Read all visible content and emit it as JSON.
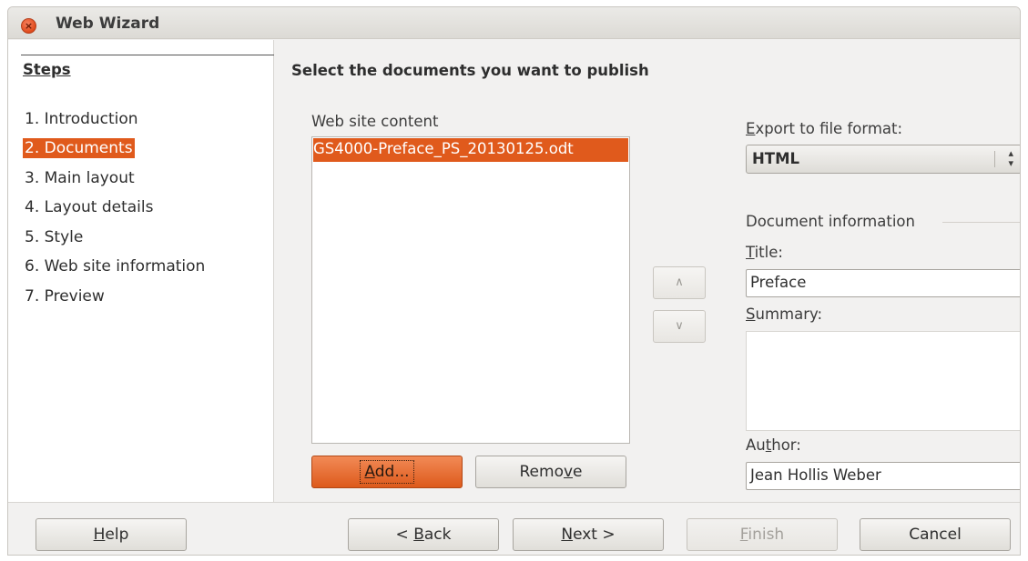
{
  "window": {
    "title": "Web Wizard"
  },
  "sidebar": {
    "heading": "Steps",
    "steps": [
      {
        "label": "1. Introduction",
        "active": false
      },
      {
        "label": "2. Documents",
        "active": true
      },
      {
        "label": "3. Main layout",
        "active": false
      },
      {
        "label": "4. Layout details",
        "active": false
      },
      {
        "label": "5. Style",
        "active": false
      },
      {
        "label": "6. Web site information",
        "active": false
      },
      {
        "label": "7. Preview",
        "active": false
      }
    ]
  },
  "main": {
    "title": "Select the documents you want to publish",
    "content_label": "Web site content",
    "content_items": [
      "GS4000-Preface_PS_20130125.odt"
    ],
    "add_button": {
      "before": "",
      "mnemonic": "A",
      "after": "dd..."
    },
    "remove_button": {
      "before": "Remo",
      "mnemonic": "v",
      "after": "e"
    },
    "move_up_glyph": "∧",
    "move_down_glyph": "∨",
    "export_label": {
      "before": "",
      "mnemonic": "E",
      "after": "xport to file format:"
    },
    "export_value": "HTML",
    "doc_info_label": "Document information",
    "title_label": {
      "before": "",
      "mnemonic": "T",
      "after": "itle:"
    },
    "title_value": "Preface",
    "summary_label": {
      "before": "",
      "mnemonic": "S",
      "after": "ummary:"
    },
    "summary_value": "",
    "author_label": {
      "before": "Au",
      "mnemonic": "t",
      "after": "hor:"
    },
    "author_value": "Jean Hollis Weber"
  },
  "footer": {
    "help": {
      "before": "",
      "mnemonic": "H",
      "after": "elp"
    },
    "back": {
      "before": "< ",
      "mnemonic": "B",
      "after": "ack"
    },
    "next": {
      "before": "",
      "mnemonic": "N",
      "after": "ext >"
    },
    "finish": {
      "before": "",
      "mnemonic": "F",
      "after": "inish"
    },
    "cancel": {
      "before": "Cancel",
      "mnemonic": "",
      "after": ""
    }
  },
  "colors": {
    "accent": "#e05a1c",
    "window_bg": "#f2f1f0",
    "text": "#3c3c3c"
  }
}
